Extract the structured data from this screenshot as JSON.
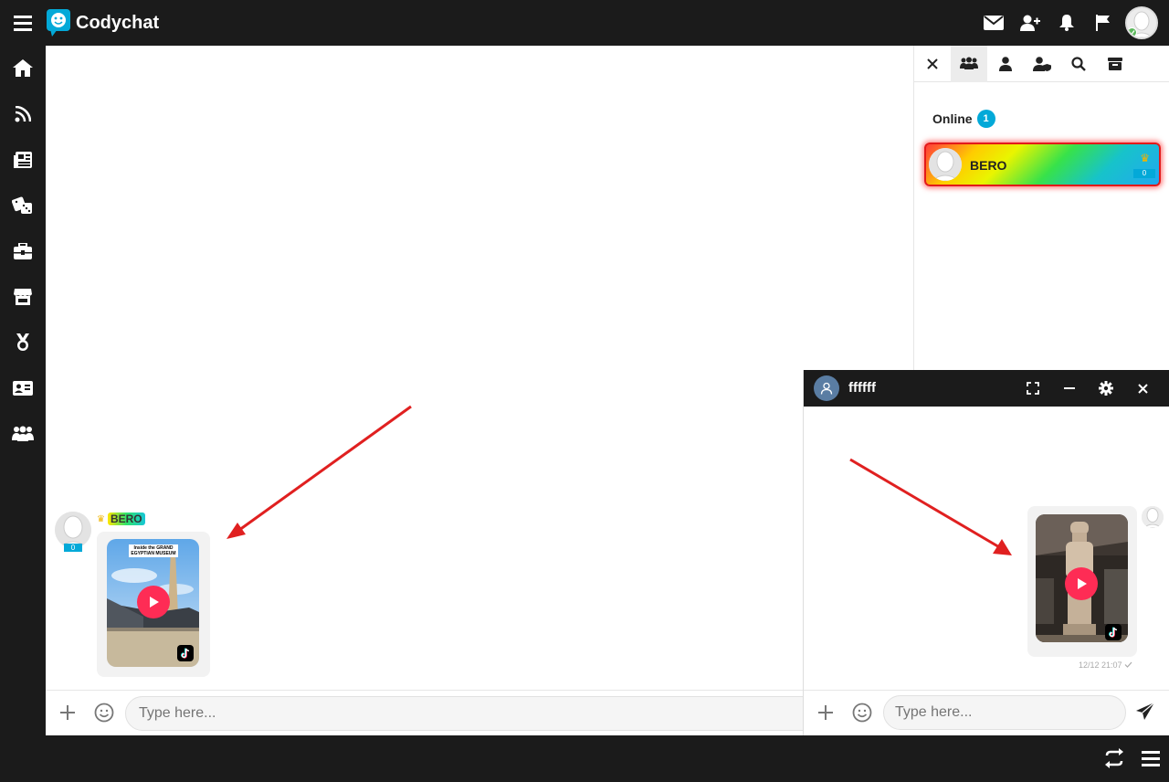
{
  "app": {
    "name": "Codychat"
  },
  "right_panel": {
    "online_label": "Online",
    "online_count": "1",
    "users": [
      {
        "name": "BERO",
        "rank": "0"
      }
    ]
  },
  "main_chat": {
    "message": {
      "username": "BERO",
      "rank": "0",
      "video_caption": "Inside the GRAND EGYPTIAN MUSEUM"
    },
    "input_placeholder": "Type here..."
  },
  "private_chat": {
    "contact_name": "ffffff",
    "timestamp": "12/12 21:07",
    "input_placeholder": "Type here..."
  },
  "colors": {
    "dark_bar": "#1b1b1b",
    "accent": "#03a9d8",
    "tiktok_play": "#fe2c55",
    "annotation_arrow": "#e02020"
  },
  "icons": {
    "top": [
      "menu-icon",
      "envelope-icon",
      "add-friend-icon",
      "bell-icon",
      "flag-icon"
    ],
    "sidebar": [
      "home-icon",
      "rss-icon",
      "news-icon",
      "dice-icon",
      "toolbox-icon",
      "store-icon",
      "medal-icon",
      "id-card-icon",
      "group-icon"
    ],
    "panel_tabs": [
      "close-icon",
      "users-icon",
      "user-icon",
      "user-shield-icon",
      "search-icon",
      "archive-icon"
    ],
    "bottom": [
      "switch-icon",
      "menu-icon"
    ]
  }
}
